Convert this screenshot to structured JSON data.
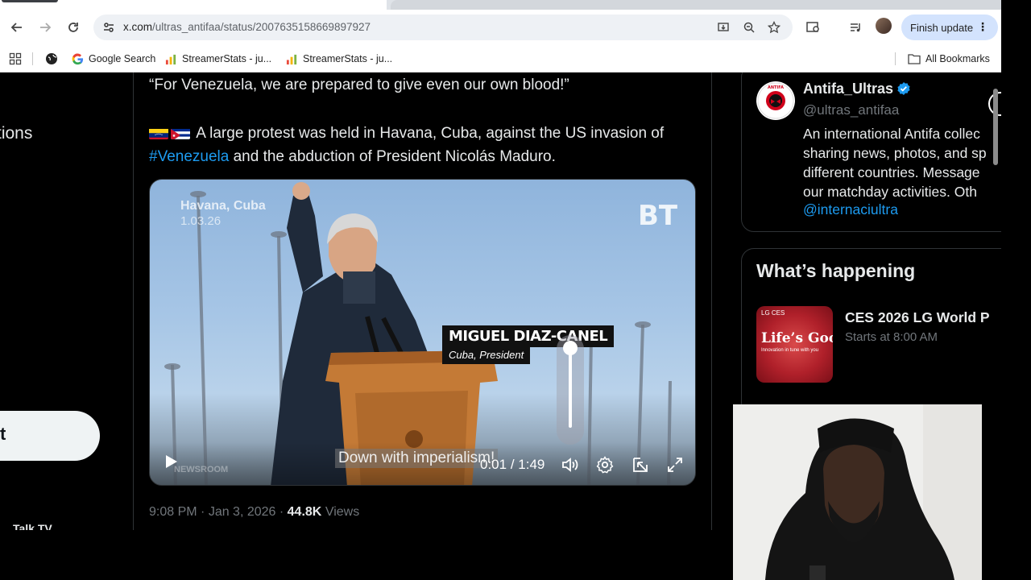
{
  "browser": {
    "url_host": "x.com",
    "url_path": "/ultras_antifaa/status/2007635158669897927",
    "finish_update_label": "Finish update",
    "bookmarks": [
      {
        "label": "Google Search"
      },
      {
        "label": "StreamerStats - ju..."
      },
      {
        "label": "StreamerStats - ju..."
      }
    ],
    "all_bookmarks_label": "All Bookmarks"
  },
  "left_nav": {
    "notifications_partial": "tions",
    "post_button_partial": "t",
    "bottom_partial": "Talk TV"
  },
  "tweet": {
    "quote": "“For Venezuela, we are prepared to give even our own blood!”",
    "body_part1": "A large protest was held in Havana, Cuba, against the US invasion of ",
    "hashtag": "#Venezuela",
    "body_part2": " and the abduction of President Nicolás Maduro.",
    "flags": [
      "venezuela-flag",
      "cuba-flag"
    ],
    "time": "9:08 PM",
    "date": "Jan 3, 2026",
    "views_count": "44.8K",
    "views_label": "Views"
  },
  "video": {
    "location": "Havana, Cuba",
    "date": "1.03.26",
    "logo": "BT",
    "lower_third_name": "MIGUEL DIAZ-CANEL",
    "lower_third_title": "Cuba, President",
    "subtitle": "Down with imperialism!",
    "watermark": "NEWSROOM",
    "current_time": "0:01",
    "duration": "1:49",
    "volume_level": 1.0
  },
  "sidebar": {
    "profile_name": "Antifa_Ultras",
    "profile_handle": "@ultras_antifaa",
    "bio_lines": [
      "An international Antifa collec",
      "sharing news, photos, and sp",
      "different countries. Message",
      "our matchday activities. Oth"
    ],
    "bio_mention": "@internaciultra",
    "happening_title": "What’s happening",
    "trend_title": "CES 2026 LG World P",
    "trend_time": "Starts at 8:00 AM",
    "trend_thumb_brand": "LG CES",
    "trend_thumb_text": "Life’s Good.",
    "trend_thumb_tagline": "Innovation in tune with you"
  },
  "colors": {
    "accent": "#1d9bf0",
    "text_primary": "#e7e9ea",
    "text_secondary": "#71767b",
    "border": "#2f3336"
  }
}
